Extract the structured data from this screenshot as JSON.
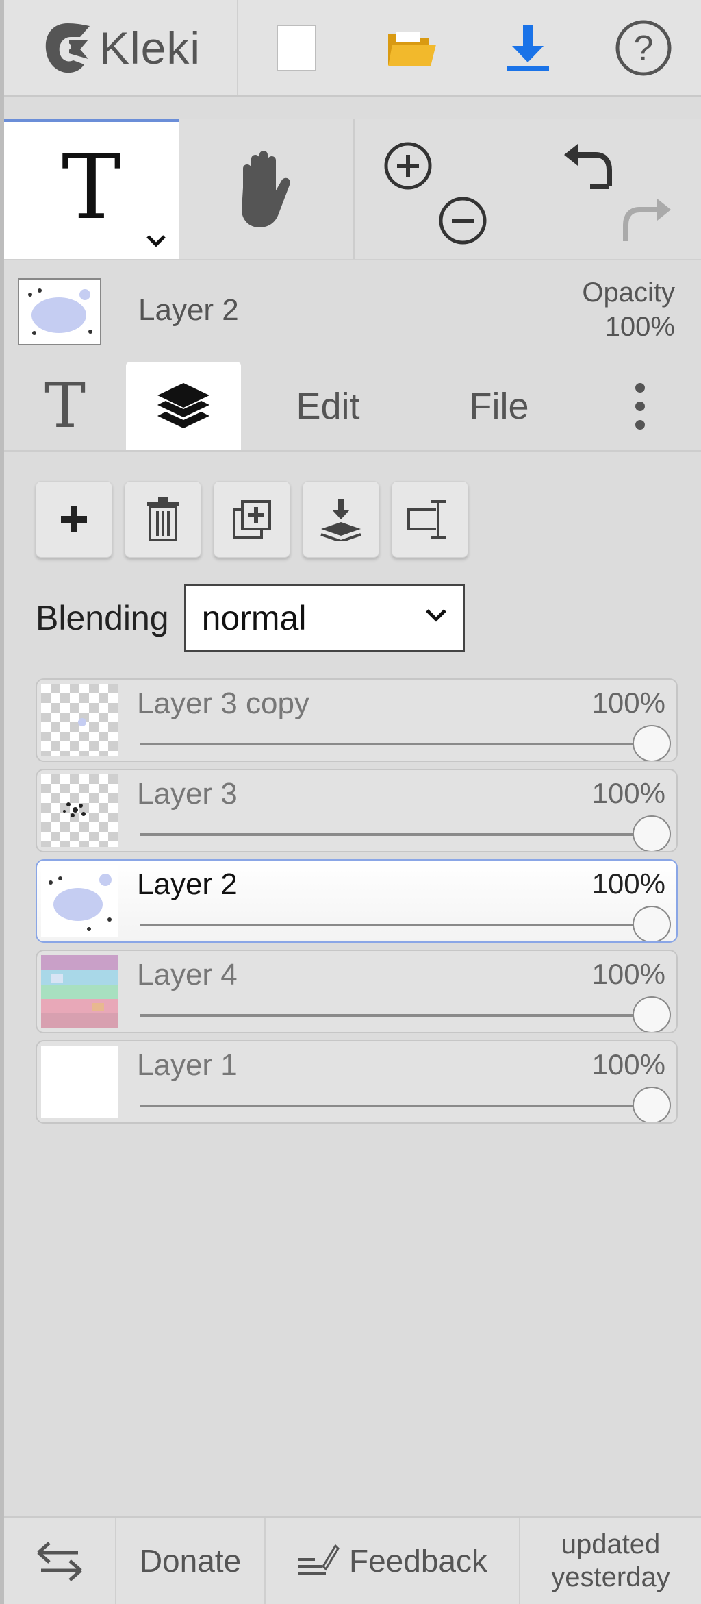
{
  "app": {
    "name": "Kleki"
  },
  "topbar": {
    "icons": [
      "kleki-logo-icon",
      "new-image-icon",
      "open-folder-icon",
      "download-icon",
      "help-icon"
    ]
  },
  "tools": {
    "active_tool": "text",
    "icons": [
      "text-tool-icon",
      "hand-tool-icon",
      "zoom-in-icon",
      "zoom-out-icon",
      "undo-icon",
      "redo-icon"
    ]
  },
  "current_layer": {
    "name": "Layer 2",
    "opacity_label": "Opacity",
    "opacity_value": "100%"
  },
  "tabs": {
    "edit": "Edit",
    "file": "File",
    "active": "layers"
  },
  "layer_actions": [
    "add-layer",
    "delete-layer",
    "duplicate-layer",
    "merge-down",
    "rename-layer"
  ],
  "blending": {
    "label": "Blending",
    "value": "normal"
  },
  "layers": [
    {
      "name": "Layer 3 copy",
      "opacity": "100%",
      "opacity_fraction": 1.0,
      "selected": false
    },
    {
      "name": "Layer 3",
      "opacity": "100%",
      "opacity_fraction": 1.0,
      "selected": false
    },
    {
      "name": "Layer 2",
      "opacity": "100%",
      "opacity_fraction": 1.0,
      "selected": true
    },
    {
      "name": "Layer 4",
      "opacity": "100%",
      "opacity_fraction": 1.0,
      "selected": false
    },
    {
      "name": "Layer 1",
      "opacity": "100%",
      "opacity_fraction": 1.0,
      "selected": false
    }
  ],
  "bottom": {
    "donate": "Donate",
    "feedback": "Feedback",
    "updated_line1": "updated",
    "updated_line2": "yesterday"
  },
  "colors": {
    "accent_blue": "#1a73e8",
    "folder_yellow": "#f2b92c",
    "selection_border": "#8aa6e6"
  }
}
